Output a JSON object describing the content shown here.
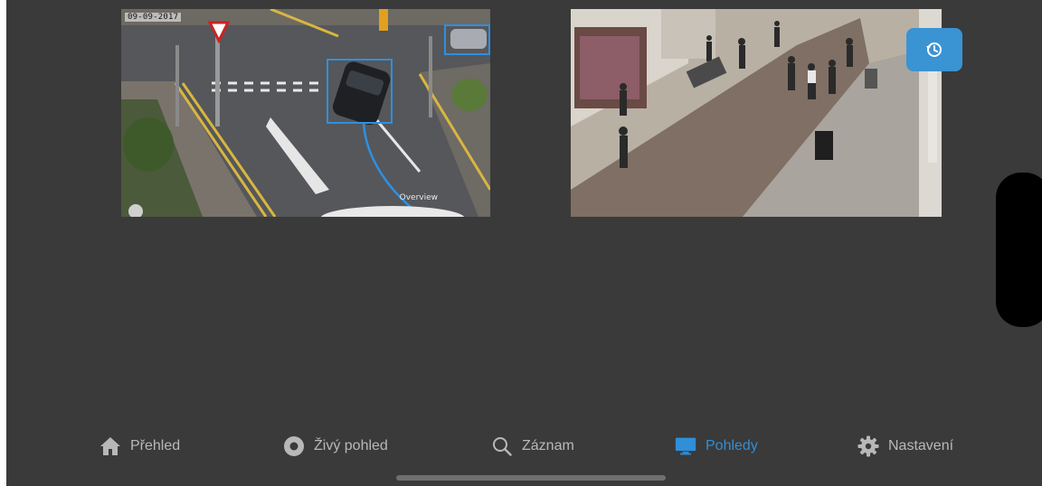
{
  "colors": {
    "background": "#3a3a3a",
    "accent": "#2f8fd8",
    "history_button": "#3a93d3",
    "nav_inactive": "#b8b8b8"
  },
  "cameras": [
    {
      "stamp": "09-09-2017",
      "overlay_label": "Overview",
      "detections": [
        "car",
        "car"
      ]
    },
    {
      "stamp": "",
      "overlay_label": "",
      "detections": []
    }
  ],
  "history_button": {
    "icon": "history-icon"
  },
  "bottom_nav": {
    "items": [
      {
        "label": "Přehled",
        "icon": "home-icon",
        "active": false
      },
      {
        "label": "Živý pohled",
        "icon": "live-view-icon",
        "active": false
      },
      {
        "label": "Záznam",
        "icon": "search-icon",
        "active": false
      },
      {
        "label": "Pohledy",
        "icon": "monitor-icon",
        "active": true
      },
      {
        "label": "Nastavení",
        "icon": "gear-icon",
        "active": false
      }
    ]
  }
}
